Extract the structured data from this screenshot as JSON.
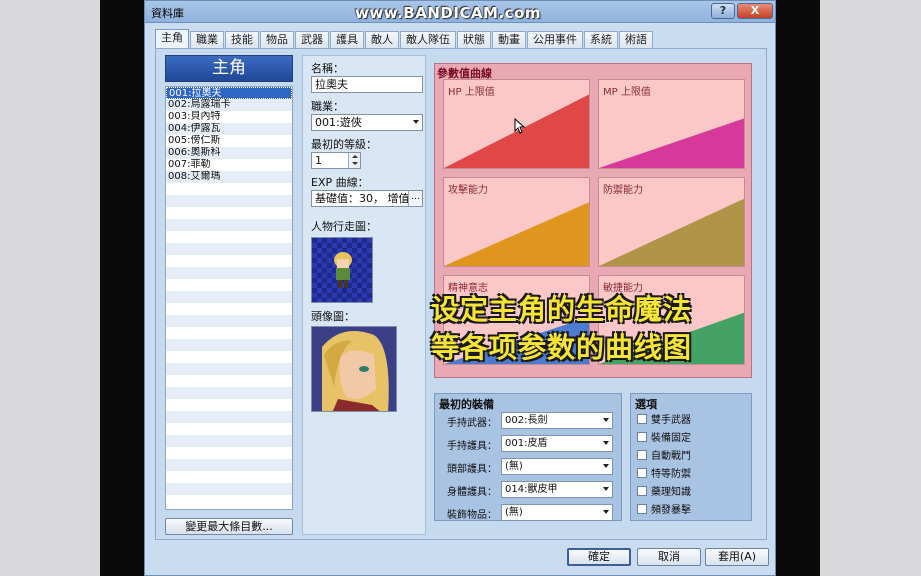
{
  "window": {
    "title": "資料庫",
    "watermark": "www.BANDICAM.com",
    "help_label": "?",
    "close_label": "X"
  },
  "tabs": [
    "主角",
    "職業",
    "技能",
    "物品",
    "武器",
    "護具",
    "敵人",
    "敵人隊伍",
    "狀態",
    "動畫",
    "公用事件",
    "系統",
    "術語"
  ],
  "heroes": {
    "header": "主角",
    "items": [
      "001:拉奧夫",
      "002:烏露瑞卡",
      "003:貝內特",
      "004:伊露瓦",
      "005:傍仁斯",
      "006:奧斯科",
      "007:菲勒",
      "008:艾爾瑪"
    ],
    "selected_index": 0,
    "change_max_button": "變更最大條目數..."
  },
  "form": {
    "name_label": "名稱：",
    "name_value": "拉奧夫",
    "class_label": "職業：",
    "class_value": "001:遊俠",
    "initial_level_label": "最初的等級：",
    "initial_level_value": "1",
    "exp_label": "EXP 曲線：",
    "exp_value": "基礎值：30， 增值：",
    "character_graphic_label": "人物行走圖：",
    "face_graphic_label": "頭像圖："
  },
  "curves": {
    "title": "參數值曲線",
    "items": [
      {
        "label": "HP 上限值",
        "color": "#e04848"
      },
      {
        "label": "MP 上限值",
        "color": "#d6399a"
      },
      {
        "label": "攻擊能力",
        "color": "#e0961e"
      },
      {
        "label": "防禦能力",
        "color": "#b09448"
      },
      {
        "label": "精神意志",
        "color": "#4c7bd0"
      },
      {
        "label": "敏捷能力",
        "color": "#44a264"
      }
    ]
  },
  "overlay": {
    "line1": "设定主角的生命魔法",
    "line2": "等各项参数的曲线图"
  },
  "equipment": {
    "title": "最初的裝備",
    "rows": [
      {
        "label": "手持武器：",
        "value": "002:長劍"
      },
      {
        "label": "手持護具：",
        "value": "001:皮盾"
      },
      {
        "label": "頭部護具：",
        "value": "(無)"
      },
      {
        "label": "身體護具：",
        "value": "014:獸皮甲"
      },
      {
        "label": "裝飾物品：",
        "value": "(無)"
      }
    ]
  },
  "options": {
    "title": "選項",
    "items": [
      {
        "label": "雙手武器",
        "checked": false
      },
      {
        "label": "裝備固定",
        "checked": false
      },
      {
        "label": "自動戰鬥",
        "checked": false
      },
      {
        "label": "特等防禦",
        "checked": false
      },
      {
        "label": "藥理知識",
        "checked": false
      },
      {
        "label": "頻發暴擊",
        "checked": false
      }
    ]
  },
  "buttons": {
    "ok": "確定",
    "cancel": "取消",
    "apply": "套用(A)"
  }
}
